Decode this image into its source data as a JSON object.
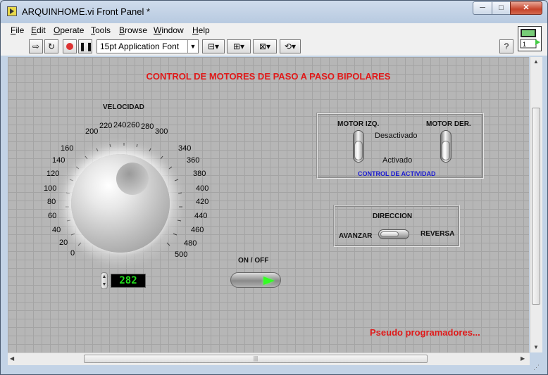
{
  "window": {
    "title": "ARQUINHOME.vi Front Panel *",
    "controls": {
      "minimize": "─",
      "maximize": "□",
      "close": "✕"
    }
  },
  "menu": [
    "File",
    "Edit",
    "Operate",
    "Tools",
    "Browse",
    "Window",
    "Help"
  ],
  "toolbar": {
    "run_icon": "run-arrow-icon",
    "run_continuous_icon": "run-continuous-icon",
    "abort_icon": "abort-icon",
    "pause_icon": "pause-icon",
    "font": "15pt Application Font",
    "help": "?"
  },
  "connector_pane": {
    "label": "1"
  },
  "panel": {
    "title": "CONTROL DE MOTORES DE PASO A PASO BIPOLARES",
    "velocidad": {
      "label": "VELOCIDAD",
      "ticks": [
        "0",
        "20",
        "40",
        "60",
        "80",
        "100",
        "120",
        "140",
        "160",
        "200",
        "220",
        "240",
        "260",
        "280",
        "300",
        "340",
        "360",
        "380",
        "400",
        "420",
        "440",
        "460",
        "480",
        "500"
      ],
      "value": "282",
      "min": 0,
      "max": 500
    },
    "onoff": {
      "label": "ON / OFF",
      "state": "on"
    },
    "motors": {
      "left_label": "MOTOR IZQ.",
      "right_label": "MOTOR DER.",
      "off_text": "Desactivado",
      "on_text": "Activado",
      "caption": "CONTROL DE ACTIVIDAD"
    },
    "direccion": {
      "label": "DIRECCION",
      "left": "AVANZAR",
      "right": "REVERSA"
    },
    "footer": "Pseudo programadores..."
  },
  "colors": {
    "accent_red": "#e01a1a",
    "digital_green": "#22e01c",
    "label_blue": "#1a1ad0"
  }
}
